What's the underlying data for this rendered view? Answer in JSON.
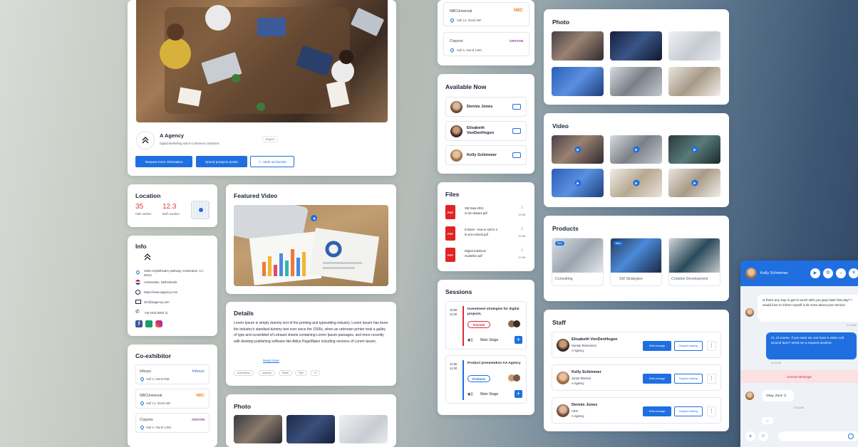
{
  "profile": {
    "company": "A Agency",
    "tagline": "Digital Marketing and E-Commerce Solutions",
    "badge": "Expert",
    "btn_request": "Request more information",
    "btn_spend": "Spend prospect points",
    "btn_favorite": "Mark as favorite"
  },
  "location": {
    "title": "Location",
    "hall_value": "35",
    "hall_label": "Hall number",
    "booth_value": "12.3",
    "booth_label": "Both number"
  },
  "info": {
    "title": "Info",
    "address": "1600 Amphitheatre parkway, Amsterdam, CA 94111",
    "country": "Amsterdam, Netherlands",
    "website": "https://www.aagency.com",
    "email": "info@aagency.com",
    "phone": "+40 4515 6000 11"
  },
  "coexhibitor": {
    "title": "Co-exhibitor",
    "items": [
      {
        "name": "Infosys",
        "stand": "Hall 3, Stand 56B",
        "logo": "Infosys"
      },
      {
        "name": "NBCUniversal",
        "stand": "Hall 14, Stand 56F",
        "logo": "NBC"
      },
      {
        "name": "Crayons",
        "stand": "Hall 9, Stand 145G",
        "logo": "CRAYON"
      }
    ]
  },
  "featured": {
    "title": "Featured Video"
  },
  "details": {
    "title": "Details",
    "text": "Lorem Ipsum is simply dummy text of the printing and typesetting industry. Lorem Ipsum has been the industry's standard dummy text ever since the 1500s, when an unknown printer took a galley of type and scrambled of Letraset sheets containing Lorem Ipsum passages, and more recently with desktop publishing software like Aldus PageMaker including versions of Lorem Ipsum.",
    "read_more": "Read more",
    "tags": [
      "Automation",
      "Industry",
      "Metal",
      "Pipe",
      "+4"
    ]
  },
  "photo_left": {
    "title": "Photo"
  },
  "coex_top": [
    {
      "name": "NBCUniversal",
      "stand": "Hall 14, Stand 56F",
      "logo": "NBC"
    },
    {
      "name": "Crayons",
      "stand": "Hall 9, Stand 145G",
      "logo": "CRAYON"
    }
  ],
  "available": {
    "title": "Available Now",
    "people": [
      "Dennis Jones",
      "Elisabeth VonDenHogen",
      "Kelly Schimmer"
    ]
  },
  "files": {
    "title": "Files",
    "badge": "PDF",
    "items": [
      {
        "name": "SM Data 2021",
        "file": "sr-sm-data21.pdf",
        "size": "16 MB"
      },
      {
        "name": "E-Book - How to sell in 2.",
        "file": "br-pm-ecbook.pdf",
        "size": "24 MB"
      },
      {
        "name": "Digital Solutions",
        "file": "Guideline.pdf",
        "size": "12 MB"
      }
    ]
  },
  "sessions": {
    "title": "Sessions",
    "items": [
      {
        "start": "10:00",
        "end": "11:30",
        "title": "Investment strategies for digital projects.",
        "tag": "Keynote",
        "stage": "Main Stage"
      },
      {
        "start": "10:30",
        "end": "11:30",
        "title": "Product presentation AA Agency",
        "tag": "Products",
        "stage": "Main Stage"
      }
    ]
  },
  "photo": {
    "title": "Photo"
  },
  "video": {
    "title": "Video"
  },
  "products": {
    "title": "Products",
    "new_badge": "New",
    "items": [
      "Consulting",
      "SM Strategies",
      "Creative Development"
    ]
  },
  "staff": {
    "title": "Staff",
    "btn_write": "Write message",
    "btn_meet": "Request meeting",
    "members": [
      {
        "name": "Elisabeth VonDenHogen",
        "role": "Human Resources",
        "company": "A Agency"
      },
      {
        "name": "Kelly Schimmer",
        "role": "Junior Director",
        "company": "A Agency"
      },
      {
        "name": "Dennis Jones",
        "role": "CEO",
        "company": "A Agency"
      }
    ]
  },
  "chat": {
    "name": "Kelly Schimmer",
    "msg1": "Is there any way to get in touch with you guys later that day? I would love to inform myself a bit more about your service.",
    "time1": "11:14 AM",
    "msg2": "Hi, of course. If you want we can have a video call around 5pm? Send me a request anytime.",
    "time2": "11:14 AM",
    "unread": "Unread Message",
    "msg3": "Okay, done :)!",
    "time3": "11:16 AM"
  },
  "colors": {
    "accent": "#1f6fe0",
    "danger": "#e02424",
    "session_red": "#d92b3a"
  }
}
